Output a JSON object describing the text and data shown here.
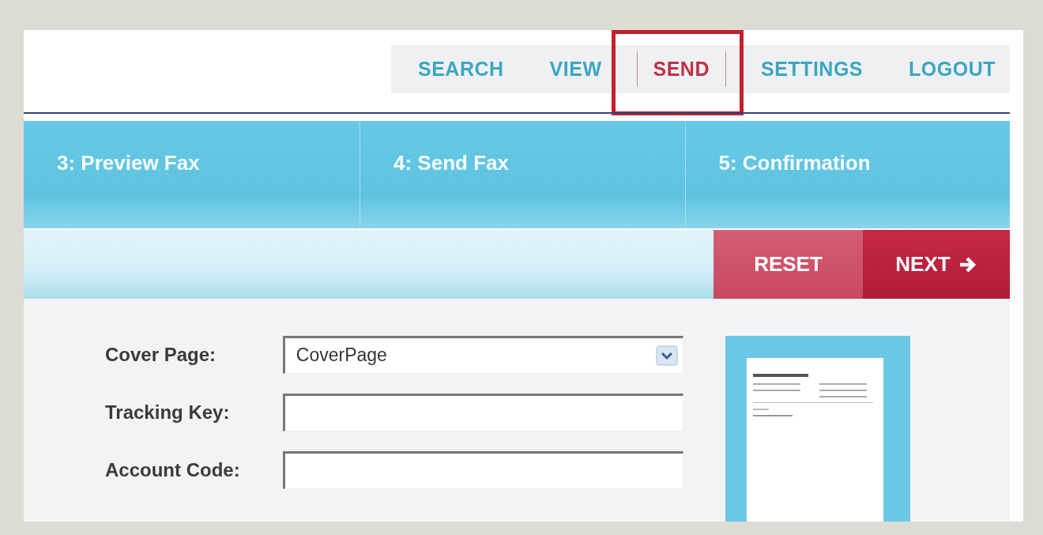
{
  "nav": [
    {
      "label": "SEARCH",
      "selected": false,
      "highlighted": false
    },
    {
      "label": "VIEW",
      "selected": false,
      "highlighted": false
    },
    {
      "label": "SEND",
      "selected": true,
      "highlighted": true
    },
    {
      "label": "SETTINGS",
      "selected": false,
      "highlighted": false
    },
    {
      "label": "LOGOUT",
      "selected": false,
      "highlighted": false
    }
  ],
  "steps": [
    "3: Preview Fax",
    "4: Send Fax",
    "5: Confirmation"
  ],
  "actions": [
    {
      "label": "RESET",
      "kind": "reset"
    },
    {
      "label": "NEXT",
      "kind": "next"
    }
  ],
  "form": [
    {
      "label": "Cover Page:",
      "kind": "dropdown",
      "value": "CoverPage"
    },
    {
      "label": "Tracking Key:",
      "kind": "text"
    },
    {
      "label": "Account Code:",
      "kind": "text"
    }
  ]
}
